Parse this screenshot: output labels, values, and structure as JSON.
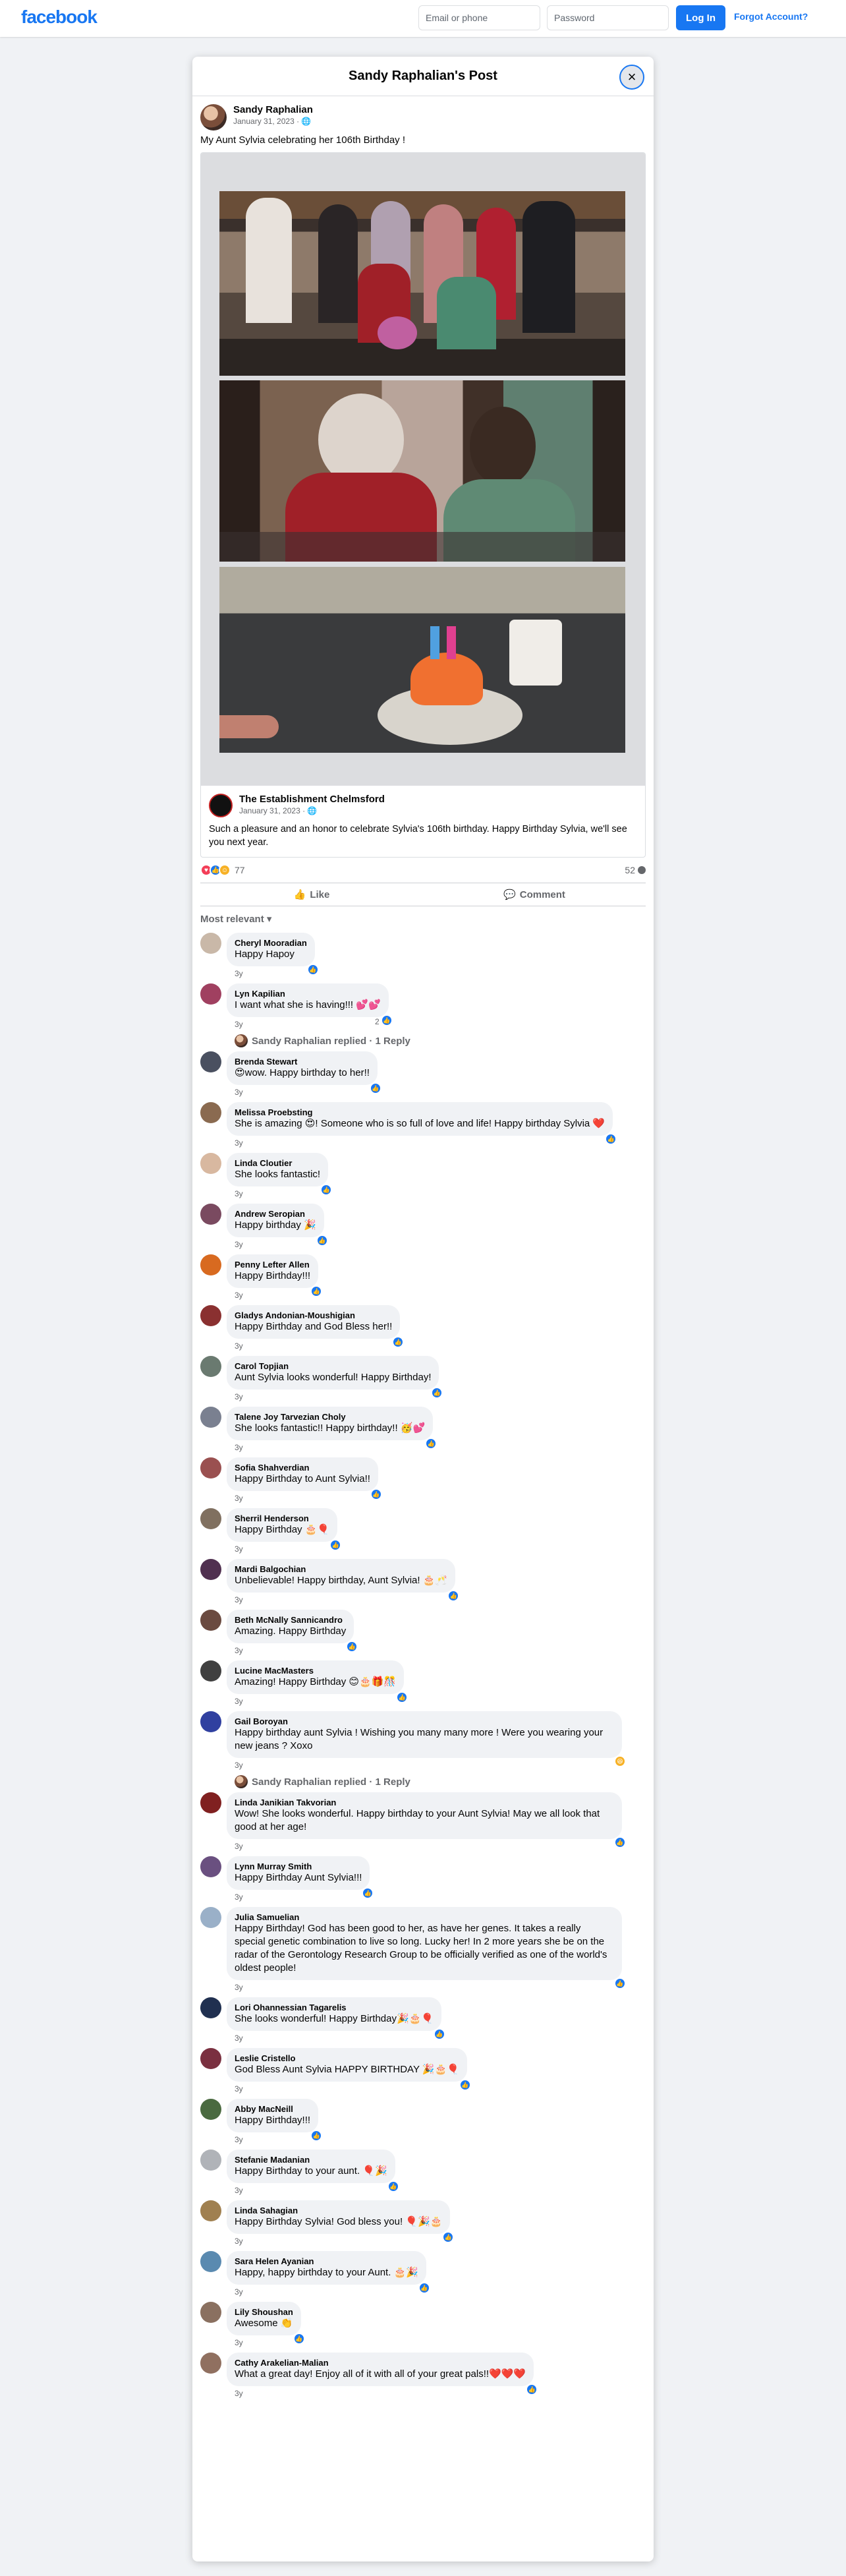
{
  "topbar": {
    "logo": "facebook",
    "email_placeholder": "Email or phone",
    "password_placeholder": "Password",
    "login_label": "Log In",
    "forgot_label": "Forgot Account?"
  },
  "modal": {
    "title": "Sandy Raphalian's Post",
    "close_icon": "×"
  },
  "post": {
    "author": "Sandy Raphalian",
    "date": "January 31, 2023 · 🌐",
    "text": "My Aunt Sylvia  celebrating her 106th Birthday !",
    "shared": {
      "author": "The Establishment Chelmsford",
      "date": "January 31, 2023 · 🌐",
      "text": "Such a pleasure and an honor to celebrate Sylvia's 106th birthday. Happy Birthday Sylvia, we'll see you next year."
    },
    "reaction_count": "77",
    "comment_count": "52",
    "like_label": "Like",
    "comment_label": "Comment",
    "sort_label": "Most relevant ▾"
  },
  "comments": [
    {
      "name": "Cheryl Mooradian",
      "text": "Happy Hapoy",
      "time": "3y",
      "color": "#c9b8a8"
    },
    {
      "name": "Lyn Kapilian",
      "text": "I want what she is having!!! 💕💕",
      "time": "3y",
      "color": "#a04060",
      "likes": "2"
    },
    {
      "name": "Brenda Stewart",
      "text": "😍wow. Happy birthday to her!!",
      "time": "3y",
      "color": "#4a5060"
    },
    {
      "name": "Melissa Proebsting",
      "text": "She is amazing 😍! Someone who is so full of love and life! Happy birthday Sylvia ❤️",
      "time": "3y",
      "color": "#8a6a50"
    },
    {
      "name": "Linda Cloutier",
      "text": "She looks fantastic!",
      "time": "3y",
      "color": "#d8b8a0"
    },
    {
      "name": "Andrew Seropian",
      "text": "Happy birthday 🎉",
      "time": "3y",
      "color": "#7a4a60"
    },
    {
      "name": "Penny Lefter Allen",
      "text": "Happy Birthday!!!",
      "time": "3y",
      "color": "#d86a20"
    },
    {
      "name": "Gladys Andonian-Moushigian",
      "text": "Happy Birthday and God Bless her!!",
      "time": "3y",
      "color": "#8a3030"
    },
    {
      "name": "Carol Topjian",
      "text": "Aunt Sylvia looks wonderful! Happy Birthday!",
      "time": "3y",
      "color": "#6a7a70"
    },
    {
      "name": "Talene Joy Tarvezian Choly",
      "text": "She looks fantastic!! Happy birthday!! 🥳💕",
      "time": "3y",
      "color": "#7a8090"
    },
    {
      "name": "Sofia Shahverdian",
      "text": "Happy Birthday to Aunt Sylvia!!",
      "time": "3y",
      "color": "#9a5050"
    },
    {
      "name": "Sherril Henderson",
      "text": "Happy Birthday 🎂🎈",
      "time": "3y",
      "color": "#807060"
    },
    {
      "name": "Mardi Balgochian",
      "text": "Unbelievable! Happy birthday, Aunt Sylvia! 🎂🥂",
      "time": "3y",
      "color": "#503050"
    },
    {
      "name": "Beth McNally Sannicandro",
      "text": "Amazing. Happy Birthday",
      "time": "3y",
      "color": "#6a4a40"
    },
    {
      "name": "Lucine MacMasters",
      "text": "Amazing! Happy Birthday 😊🎂🎁🎊",
      "time": "3y",
      "color": "#404040"
    },
    {
      "name": "Gail Boroyan",
      "text": "Happy birthday aunt Sylvia ! Wishing you many many more ! Were you wearing your new jeans ? Xoxo",
      "time": "3y",
      "color": "#3040a0",
      "emoji": "😆"
    },
    {
      "name": "Linda Janikian Takvorian",
      "text": "Wow! She looks wonderful. Happy birthday to your Aunt Sylvia! May we all look that good at her age!",
      "time": "3y",
      "color": "#802020"
    },
    {
      "name": "Lynn Murray Smith",
      "text": "Happy Birthday Aunt Sylvia!!!",
      "time": "3y",
      "color": "#6a5080"
    },
    {
      "name": "Julia Samuelian",
      "text": "Happy Birthday! God has been good to her, as have her genes. It takes a really special genetic combination to live so long. Lucky her! In 2 more years she be on the radar of the Gerontology Research Group to be officially verified as one of the world's oldest people!",
      "time": "3y",
      "color": "#9ab0c8"
    },
    {
      "name": "Lori Ohannessian Tagarelis",
      "text": "She looks wonderful! Happy Birthday🎉🎂🎈",
      "time": "3y",
      "color": "#203050"
    },
    {
      "name": "Leslie Cristello",
      "text": "God Bless Aunt Sylvia HAPPY BIRTHDAY 🎉🎂🎈",
      "time": "3y",
      "color": "#7a3040"
    },
    {
      "name": "Abby MacNeill",
      "text": "Happy Birthday!!!",
      "time": "3y",
      "color": "#4a6a40"
    },
    {
      "name": "Stefanie Madanian",
      "text": "Happy Birthday to your aunt. 🎈🎉",
      "time": "3y",
      "color": "#b0b3b8"
    },
    {
      "name": "Linda Sahagian",
      "text": "Happy Birthday Sylvia! God bless you! 🎈🎉🎂",
      "time": "3y",
      "color": "#a08050"
    },
    {
      "name": "Sara Helen Ayanian",
      "text": "Happy, happy birthday to your Aunt. 🎂🎉",
      "time": "3y",
      "color": "#5a8ab0"
    },
    {
      "name": "Lily Shoushan",
      "text": "Awesome 👏",
      "time": "3y",
      "color": "#8a7060"
    },
    {
      "name": "Cathy Arakelian-Malian",
      "text": "What a great day! Enjoy all of it with all of your great pals!!❤️❤️❤️",
      "time": "3y",
      "color": "#907060"
    }
  ],
  "replies": {
    "after_lyn": "Sandy Raphalian replied · 1 Reply",
    "after_gail": "Sandy Raphalian replied · 1 Reply"
  }
}
